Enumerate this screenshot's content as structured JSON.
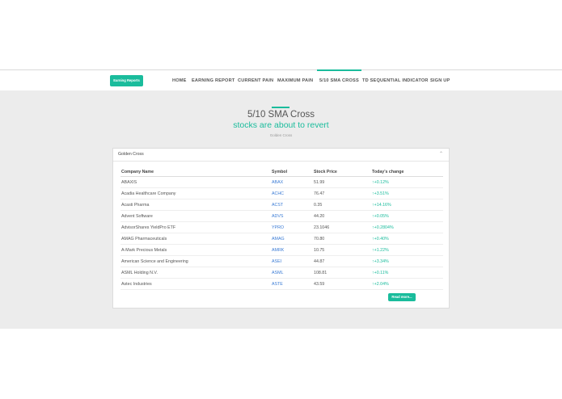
{
  "brand": {
    "label": "Earning Reports"
  },
  "nav": {
    "items": [
      {
        "label": "HOME"
      },
      {
        "label": "EARNING REPORT"
      },
      {
        "label": "CURRENT PAIN"
      },
      {
        "label": "MAXIMUM PAIN"
      },
      {
        "label": "5/10 SMA CROSS"
      },
      {
        "label": "TD SEQUENTIAL INDICATOR"
      },
      {
        "label": "SIGN UP"
      }
    ],
    "active_index": 4
  },
  "header": {
    "title": "5/10 SMA Cross",
    "subtitle": "stocks are about to revert",
    "caption": "Golden Cross"
  },
  "panel": {
    "title": "Golden Cross",
    "collapse_icon": "chevron-up-icon",
    "columns": [
      "Company Name",
      "Symbol",
      "Stock Price",
      "Today's change"
    ],
    "rows": [
      {
        "company": "ABAXIS",
        "symbol": "ABAX",
        "price": "51.99",
        "change": "↑+0.12%"
      },
      {
        "company": "Acadia Healthcare Company",
        "symbol": "ACHC",
        "price": "76.47",
        "change": "↑+3.51%"
      },
      {
        "company": "Acasti Pharma",
        "symbol": "ACST",
        "price": "0.35",
        "change": "↑+14.16%"
      },
      {
        "company": "Advent Software",
        "symbol": "ADVS",
        "price": "44.20",
        "change": "↑+0.05%"
      },
      {
        "company": "AdvisorShares YieldPro ETF",
        "symbol": "YPRO",
        "price": "23.1046",
        "change": "↑+0.2804%"
      },
      {
        "company": "AMAG Pharmaceuticals",
        "symbol": "AMAG",
        "price": "70.80",
        "change": "↑+0.40%"
      },
      {
        "company": "A-Mark Precious Metals",
        "symbol": "AMRK",
        "price": "10.75",
        "change": "↑+1.22%"
      },
      {
        "company": "American Science and Engineering",
        "symbol": "ASEI",
        "price": "44.87",
        "change": "↑+3.34%"
      },
      {
        "company": "ASML Holding N.V.",
        "symbol": "ASML",
        "price": "108.81",
        "change": "↑+0.11%"
      },
      {
        "company": "Astec Industries",
        "symbol": "ASTE",
        "price": "43.59",
        "change": "↑+2.04%"
      }
    ],
    "read_more_label": "Read more..."
  },
  "colors": {
    "accent": "#1abc9c",
    "link": "#3a7bd5",
    "background": "#ececec"
  }
}
